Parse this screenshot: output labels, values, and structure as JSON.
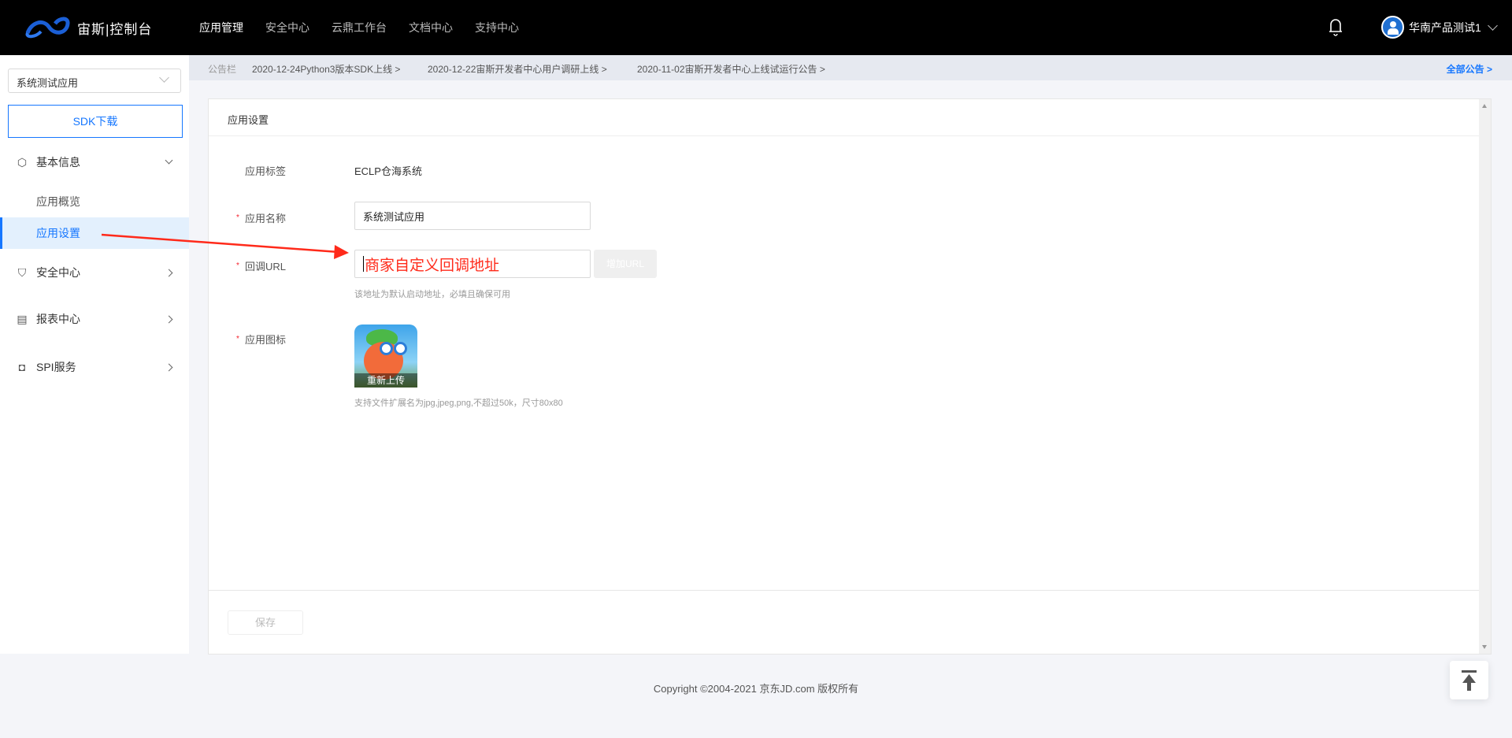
{
  "header": {
    "logo_text": "宙斯|控制台",
    "nav": [
      "应用管理",
      "安全中心",
      "云鼎工作台",
      "文档中心",
      "支持中心"
    ],
    "user_name": "华南产品测试1"
  },
  "notice": {
    "label": "公告栏",
    "items": [
      "2020-12-24Python3版本SDK上线 >",
      "2020-12-22宙斯开发者中心用户调研上线 >",
      "2020-11-02宙斯开发者中心上线试运行公告 >"
    ],
    "all": "全部公告 >"
  },
  "sidebar": {
    "app_select": "系统测试应用",
    "sdk_button": "SDK下载",
    "menu": [
      {
        "label": "基本信息",
        "icon": "cube-icon"
      },
      {
        "label": "应用概览"
      },
      {
        "label": "应用设置"
      },
      {
        "label": "安全中心",
        "icon": "shield-icon"
      },
      {
        "label": "报表中心",
        "icon": "document-icon"
      },
      {
        "label": "SPI服务",
        "icon": "bag-icon"
      }
    ]
  },
  "card": {
    "title": "应用设置",
    "fields": {
      "tag_label": "应用标签",
      "tag_value": "ECLP仓海系统",
      "name_label": "应用名称",
      "name_value": "系统测试应用",
      "url_label": "回调URL",
      "url_value": "商家自定义回调地址",
      "add_url": "增加URL",
      "url_hint": "该地址为默认启动地址，必填且确保可用",
      "icon_label": "应用图标",
      "reupload": "重新上传",
      "icon_hint": "支持文件扩展名为jpg,jpeg,png,不超过50k，尺寸80x80"
    },
    "required_mark": "*",
    "save": "保存"
  },
  "footer": {
    "copyright": "Copyright ©2004-2021 京东JD.com 版权所有"
  },
  "colors": {
    "accent": "#1677ff",
    "annotation": "#ff2a1a"
  }
}
